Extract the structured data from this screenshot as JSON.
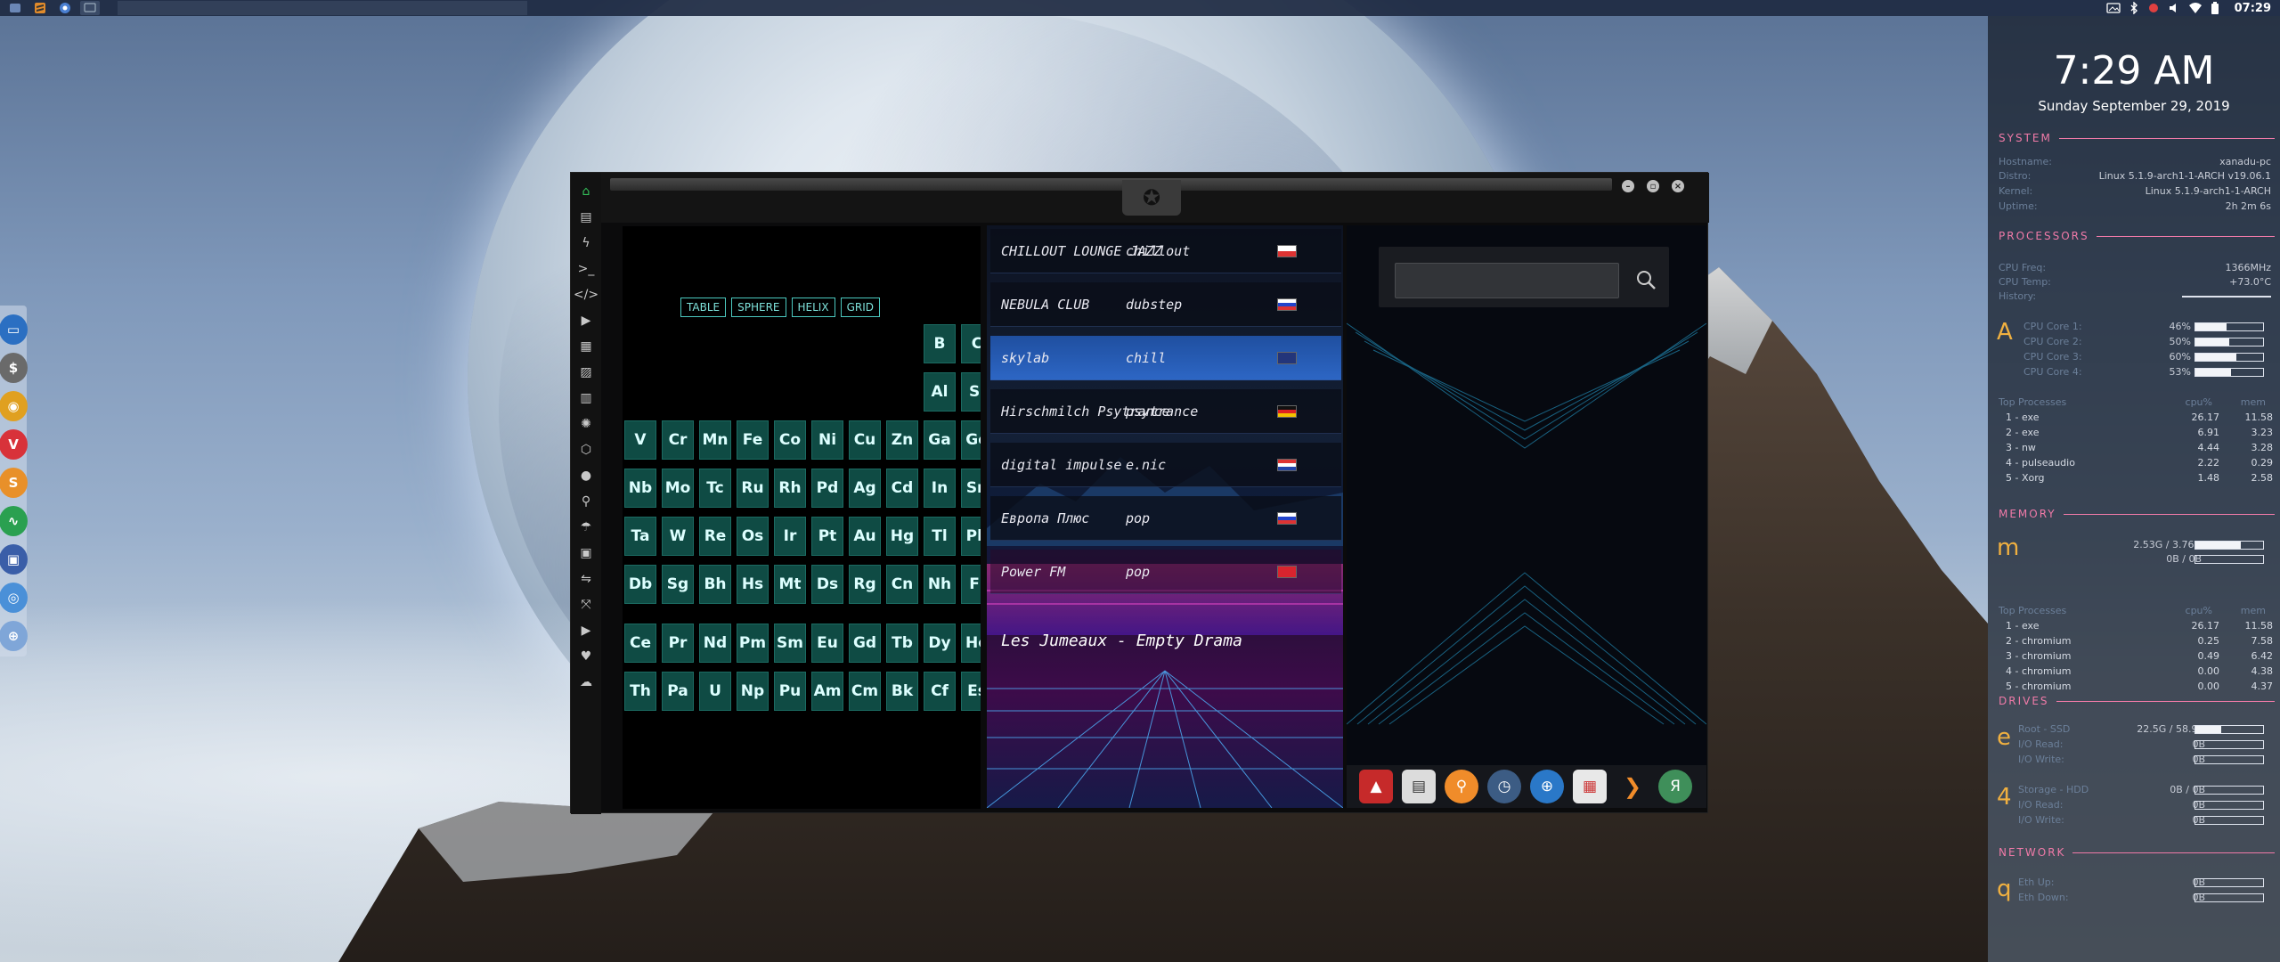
{
  "topbar": {
    "apps": [
      "menu-icon",
      "sublime-icon",
      "chromium-icon",
      "desktop-icon"
    ],
    "tray_icons": [
      "screenshot-icon",
      "bluetooth-icon",
      "redshift-icon",
      "volume-icon",
      "wifi-icon",
      "battery-icon"
    ],
    "clock": "07:29"
  },
  "dock": {
    "items": [
      "files-icon",
      "terminal-icon",
      "chromium-icon",
      "vivaldi-icon",
      "sublime-icon",
      "system-monitor-icon",
      "desktop-icon",
      "chrome-icon",
      "globe-icon"
    ]
  },
  "window": {
    "toolbar_icons": [
      "home-icon",
      "document-icon",
      "bolt-icon",
      "terminal-icon",
      "code-icon",
      "play-icon",
      "translate-icon",
      "image-icon",
      "news-icon",
      "atom-icon",
      "cube-icon",
      "globe-icon",
      "search-icon",
      "umbrella-icon",
      "portrait-icon",
      "swap-icon",
      "fullscreen-icon",
      "youtube-icon",
      "heart-icon",
      "cloud-icon"
    ],
    "emblem": "rebel-alliance-icon"
  },
  "periodic_table": {
    "tabs": [
      "TABLE",
      "SPHERE",
      "HELIX",
      "GRID"
    ],
    "elements": [
      {
        "s": "B",
        "c": 8,
        "r": 0
      },
      {
        "s": "C",
        "c": 9,
        "r": 0
      },
      {
        "s": "Al",
        "c": 8,
        "r": 1
      },
      {
        "s": "Si",
        "c": 9,
        "r": 1
      },
      {
        "s": "V",
        "c": 0,
        "r": 2
      },
      {
        "s": "Cr",
        "c": 1,
        "r": 2
      },
      {
        "s": "Mn",
        "c": 2,
        "r": 2
      },
      {
        "s": "Fe",
        "c": 3,
        "r": 2
      },
      {
        "s": "Co",
        "c": 4,
        "r": 2
      },
      {
        "s": "Ni",
        "c": 5,
        "r": 2
      },
      {
        "s": "Cu",
        "c": 6,
        "r": 2
      },
      {
        "s": "Zn",
        "c": 7,
        "r": 2
      },
      {
        "s": "Ga",
        "c": 8,
        "r": 2
      },
      {
        "s": "Ge",
        "c": 9,
        "r": 2
      },
      {
        "s": "Nb",
        "c": 0,
        "r": 3
      },
      {
        "s": "Mo",
        "c": 1,
        "r": 3
      },
      {
        "s": "Tc",
        "c": 2,
        "r": 3
      },
      {
        "s": "Ru",
        "c": 3,
        "r": 3
      },
      {
        "s": "Rh",
        "c": 4,
        "r": 3
      },
      {
        "s": "Pd",
        "c": 5,
        "r": 3
      },
      {
        "s": "Ag",
        "c": 6,
        "r": 3
      },
      {
        "s": "Cd",
        "c": 7,
        "r": 3
      },
      {
        "s": "In",
        "c": 8,
        "r": 3
      },
      {
        "s": "Sn",
        "c": 9,
        "r": 3
      },
      {
        "s": "Ta",
        "c": 0,
        "r": 4
      },
      {
        "s": "W",
        "c": 1,
        "r": 4
      },
      {
        "s": "Re",
        "c": 2,
        "r": 4
      },
      {
        "s": "Os",
        "c": 3,
        "r": 4
      },
      {
        "s": "Ir",
        "c": 4,
        "r": 4
      },
      {
        "s": "Pt",
        "c": 5,
        "r": 4
      },
      {
        "s": "Au",
        "c": 6,
        "r": 4
      },
      {
        "s": "Hg",
        "c": 7,
        "r": 4
      },
      {
        "s": "Tl",
        "c": 8,
        "r": 4
      },
      {
        "s": "Pb",
        "c": 9,
        "r": 4
      },
      {
        "s": "Db",
        "c": 0,
        "r": 5
      },
      {
        "s": "Sg",
        "c": 1,
        "r": 5
      },
      {
        "s": "Bh",
        "c": 2,
        "r": 5
      },
      {
        "s": "Hs",
        "c": 3,
        "r": 5
      },
      {
        "s": "Mt",
        "c": 4,
        "r": 5
      },
      {
        "s": "Ds",
        "c": 5,
        "r": 5
      },
      {
        "s": "Rg",
        "c": 6,
        "r": 5
      },
      {
        "s": "Cn",
        "c": 7,
        "r": 5
      },
      {
        "s": "Nh",
        "c": 8,
        "r": 5
      },
      {
        "s": "Fl",
        "c": 9,
        "r": 5
      },
      {
        "s": "Ce",
        "c": 0,
        "r": 7
      },
      {
        "s": "Pr",
        "c": 1,
        "r": 7
      },
      {
        "s": "Nd",
        "c": 2,
        "r": 7
      },
      {
        "s": "Pm",
        "c": 3,
        "r": 7
      },
      {
        "s": "Sm",
        "c": 4,
        "r": 7
      },
      {
        "s": "Eu",
        "c": 5,
        "r": 7
      },
      {
        "s": "Gd",
        "c": 6,
        "r": 7
      },
      {
        "s": "Tb",
        "c": 7,
        "r": 7
      },
      {
        "s": "Dy",
        "c": 8,
        "r": 7
      },
      {
        "s": "Ho",
        "c": 9,
        "r": 7
      },
      {
        "s": "Th",
        "c": 0,
        "r": 8
      },
      {
        "s": "Pa",
        "c": 1,
        "r": 8
      },
      {
        "s": "U",
        "c": 2,
        "r": 8
      },
      {
        "s": "Np",
        "c": 3,
        "r": 8
      },
      {
        "s": "Pu",
        "c": 4,
        "r": 8
      },
      {
        "s": "Am",
        "c": 5,
        "r": 8
      },
      {
        "s": "Cm",
        "c": 6,
        "r": 8
      },
      {
        "s": "Bk",
        "c": 7,
        "r": 8
      },
      {
        "s": "Cf",
        "c": 8,
        "r": 8
      },
      {
        "s": "Es",
        "c": 9,
        "r": 8
      }
    ]
  },
  "radio": {
    "stations": [
      {
        "name": "CHILLOUT LOUNGE JAZZ",
        "genre": "chillout",
        "flag": "pl"
      },
      {
        "name": "NEBULA CLUB",
        "genre": "dubstep",
        "flag": "ru"
      },
      {
        "name": "skylab",
        "genre": "chill",
        "flag": "gb"
      },
      {
        "name": "Hirschmilch Psytrance",
        "genre": "psytrance",
        "flag": "de"
      },
      {
        "name": "digital impulse",
        "genre": "e.nic",
        "flag": "hr"
      },
      {
        "name": "Европа Плюс",
        "genre": "pop",
        "flag": "ru"
      },
      {
        "name": "Power FM",
        "genre": "pop",
        "flag": "tr"
      }
    ],
    "active_index": 2,
    "now_playing": "Les Jumeaux - Empty Drama"
  },
  "search": {
    "value": "",
    "button_icon": "search-icon"
  },
  "inner_dock": [
    "arch-icon",
    "news-icon",
    "search-icon",
    "clock-icon",
    "globe-icon",
    "calendar-icon",
    "arrow-icon",
    "yandex-icon"
  ],
  "conky": {
    "time": "7:29 AM",
    "date": "Sunday September 29, 2019",
    "system": {
      "title": "SYSTEM",
      "rows": [
        {
          "label": "Hostname:",
          "value": "xanadu-pc"
        },
        {
          "label": "Distro:",
          "value": "Linux 5.1.9-arch1-1-ARCH v19.06.1"
        },
        {
          "label": "Kernel:",
          "value": "Linux 5.1.9-arch1-1-ARCH"
        },
        {
          "label": "Uptime:",
          "value": "2h 2m 6s"
        }
      ]
    },
    "processors": {
      "title": "PROCESSORS",
      "freq_label": "CPU Freq:",
      "freq": "1366MHz",
      "temp_label": "CPU Temp:",
      "temp": "+73.0°C",
      "history_label": "History:",
      "glyph": "A",
      "cores": [
        {
          "label": "CPU Core 1:",
          "value": "46%",
          "pct": 46
        },
        {
          "label": "CPU Core 2:",
          "value": "50%",
          "pct": 50
        },
        {
          "label": "CPU Core 3:",
          "value": "60%",
          "pct": 60
        },
        {
          "label": "CPU Core 4:",
          "value": "53%",
          "pct": 53
        }
      ],
      "top_header": "Top Processes",
      "cpu_header": "cpu%",
      "mem_header": "mem",
      "top": [
        {
          "name": "1 - exe",
          "cpu": "26.17",
          "mem": "11.58"
        },
        {
          "name": "2 - exe",
          "cpu": "6.91",
          "mem": "3.23"
        },
        {
          "name": "3 - nw",
          "cpu": "4.44",
          "mem": "3.28"
        },
        {
          "name": "4 - pulseaudio",
          "cpu": "2.22",
          "mem": "0.29"
        },
        {
          "name": "5 - Xorg",
          "cpu": "1.48",
          "mem": "2.58"
        }
      ]
    },
    "memory": {
      "title": "MEMORY",
      "glyph": "m",
      "ram": "2.53G / 3.76G",
      "ram_pct": 67,
      "swap": "0B / 0B",
      "swap_pct": 0,
      "top_header": "Top Processes",
      "cpu_header": "cpu%",
      "mem_header": "mem",
      "top": [
        {
          "name": "1 - exe",
          "cpu": "26.17",
          "mem": "11.58"
        },
        {
          "name": "2 - chromium",
          "cpu": "0.25",
          "mem": "7.58"
        },
        {
          "name": "3 - chromium",
          "cpu": "0.49",
          "mem": "6.42"
        },
        {
          "name": "4 - chromium",
          "cpu": "0.00",
          "mem": "4.38"
        },
        {
          "name": "5 - chromium",
          "cpu": "0.00",
          "mem": "4.37"
        }
      ]
    },
    "drives": {
      "title": "DRIVES",
      "d1": {
        "glyph": "e",
        "label": "Root - SSD",
        "value": "22.5G / 58.9G",
        "pct": 38,
        "read_label": "I/O Read:",
        "read": "0B",
        "write_label": "I/O Write:",
        "write": "0B"
      },
      "d2": {
        "glyph": "4",
        "label": "Storage - HDD",
        "value": "0B / 0B",
        "pct": 0,
        "read_label": "I/O Read:",
        "read": "0B",
        "write_label": "I/O Write:",
        "write": "0B"
      }
    },
    "network": {
      "title": "NETWORK",
      "glyph": "q",
      "up_label": "Eth Up:",
      "up": "0B",
      "down_label": "Eth Down:",
      "down": "0B"
    }
  }
}
